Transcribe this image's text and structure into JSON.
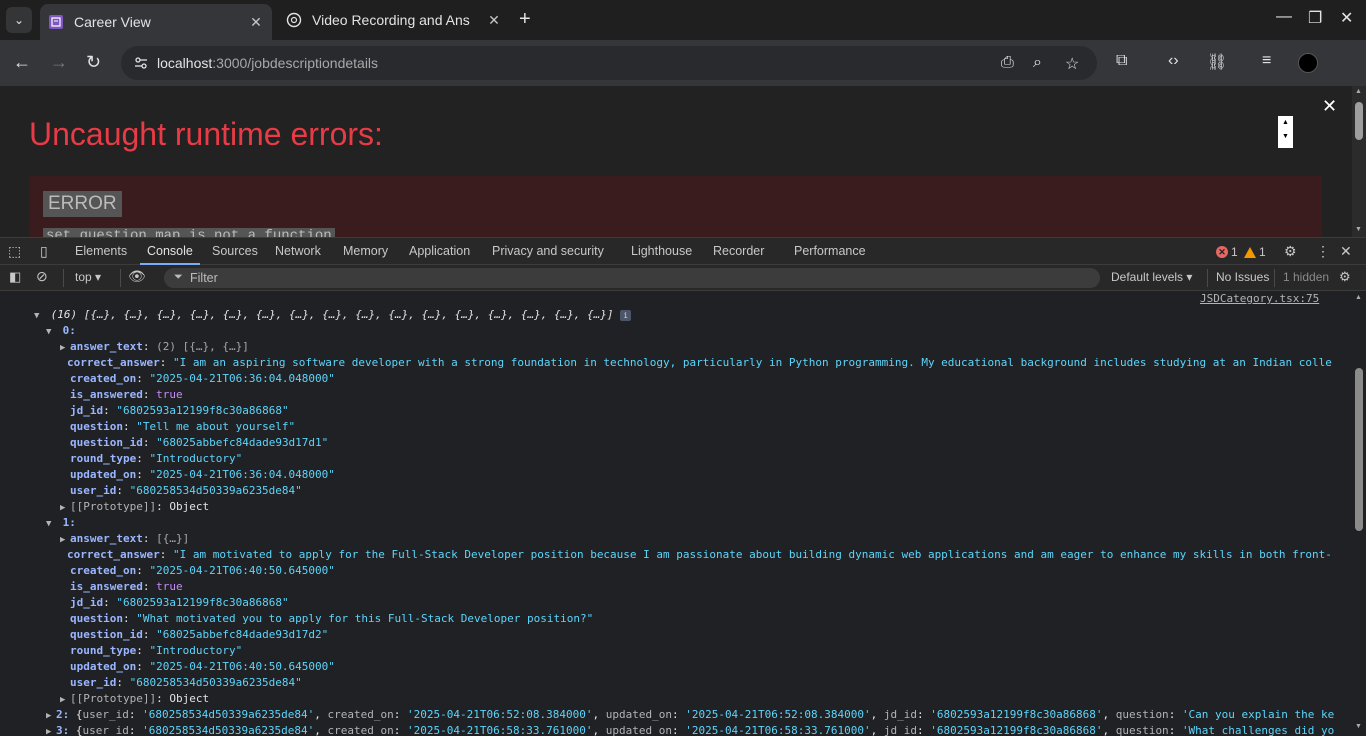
{
  "browser": {
    "tabs": [
      {
        "title": "Career View",
        "active": true
      },
      {
        "title": "Video Recording and Ans",
        "active": false
      }
    ],
    "url_host": "localhost",
    "url_path": ":3000/jobdescriptiondetails"
  },
  "overlay": {
    "title": "Uncaught runtime errors:",
    "error_label": "ERROR",
    "error_message": "set question map is not a function"
  },
  "devtools": {
    "tabs": [
      "Elements",
      "Console",
      "Sources",
      "Network",
      "Memory",
      "Application",
      "Privacy and security",
      "Lighthouse",
      "Recorder",
      "Performance"
    ],
    "selected_tab": "Console",
    "error_count": "1",
    "warning_count": "1",
    "context": "top",
    "filter_placeholder": "Filter",
    "levels": "Default levels",
    "issues": "No Issues",
    "hidden": "1 hidden"
  },
  "console": {
    "source_link": "JSDCategory.tsx:75",
    "array_summary": "(16) [{…}, {…}, {…}, {…}, {…}, {…}, {…}, {…}, {…}, {…}, {…}, {…}, {…}, {…}, {…}, {…}]",
    "items": [
      {
        "index": "0:",
        "answer_text": "(2) [{…}, {…}]",
        "correct_answer": "\"I am an aspiring software developer with a strong foundation in technology, particularly in Python programming. My educational background includes studying at an Indian colle",
        "created_on": "\"2025-04-21T06:36:04.048000\"",
        "is_answered": "true",
        "jd_id": "\"6802593a12199f8c30a86868\"",
        "question": "\"Tell me about yourself\"",
        "question_id": "\"68025abbefc84dade93d17d1\"",
        "round_type": "\"Introductory\"",
        "updated_on": "\"2025-04-21T06:36:04.048000\"",
        "user_id": "\"680258534d50339a6235de84\"",
        "prototype": "Object"
      },
      {
        "index": "1:",
        "answer_text": "[{…}]",
        "correct_answer": "\"I am motivated to apply for the Full-Stack Developer position because I am passionate about building dynamic web applications and am eager to enhance my skills in both front-",
        "created_on": "\"2025-04-21T06:40:50.645000\"",
        "is_answered": "true",
        "jd_id": "\"6802593a12199f8c30a86868\"",
        "question": "\"What motivated you to apply for this Full-Stack Developer position?\"",
        "question_id": "\"68025abbefc84dade93d17d2\"",
        "round_type": "\"Introductory\"",
        "updated_on": "\"2025-04-21T06:40:50.645000\"",
        "user_id": "\"680258534d50339a6235de84\"",
        "prototype": "Object"
      }
    ],
    "collapsed": [
      {
        "index": "2:",
        "user_id": "'680258534d50339a6235de84'",
        "created_on": "'2025-04-21T06:52:08.384000'",
        "updated_on": "'2025-04-21T06:52:08.384000'",
        "jd_id": "'6802593a12199f8c30a86868'",
        "question": "'Can you explain the ke"
      },
      {
        "index": "3:",
        "user_id": "'680258534d50339a6235de84'",
        "created_on": "'2025-04-21T06:58:33.761000'",
        "updated_on": "'2025-04-21T06:58:33.761000'",
        "jd_id": "'6802593a12199f8c30a86868'",
        "question": "'What challenges did yo"
      }
    ]
  }
}
